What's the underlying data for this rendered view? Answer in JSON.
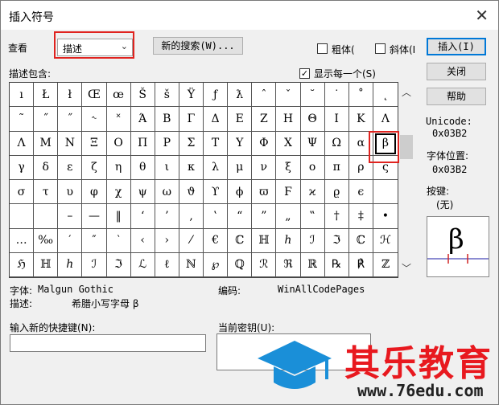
{
  "dialog": {
    "title": "插入符号",
    "close_glyph": "✕"
  },
  "search": {
    "view_label": "查看",
    "view_value": "描述",
    "new_search_label": "新的搜索(W)...",
    "bold_label": "粗体(",
    "italic_label": "斜体(I",
    "desc_contains_label": "描述包含:",
    "show_each_label": "显示每一个(S)",
    "show_each_checked": "✓"
  },
  "buttons": {
    "insert": "插入(I)",
    "close": "关闭",
    "help": "帮助"
  },
  "grid": {
    "rows": [
      [
        "ı",
        "Ł",
        "ł",
        "Œ",
        "œ",
        "Š",
        "š",
        "Ÿ",
        "ƒ",
        "ƛ",
        "ˆ",
        "ˇ",
        "˘",
        "˙",
        "˚",
        "˛"
      ],
      [
        "˜",
        "˝",
        "˝",
        "˞",
        "˟",
        "Ά",
        "Β",
        "Γ",
        "Δ",
        "Ε",
        "Ζ",
        "Η",
        "Θ",
        "Ι",
        "Κ",
        "Λ"
      ],
      [
        "Λ",
        "Μ",
        "Ν",
        "Ξ",
        "Ο",
        "Π",
        "Ρ",
        "Σ",
        "Τ",
        "Υ",
        "Φ",
        "Χ",
        "Ψ",
        "Ω",
        "α",
        "β"
      ],
      [
        "γ",
        "δ",
        "ε",
        "ζ",
        "η",
        "θ",
        "ι",
        "κ",
        "λ",
        "μ",
        "ν",
        "ξ",
        "ο",
        "π",
        "ρ",
        "ς"
      ],
      [
        "σ",
        "τ",
        "υ",
        "φ",
        "χ",
        "ψ",
        "ω",
        "ϑ",
        "ϒ",
        "ϕ",
        "ϖ",
        "Ϝ",
        "ϰ",
        "ϱ",
        "ϵ",
        ""
      ],
      [
        "",
        "",
        "–",
        "—",
        "‖",
        "‘",
        "’",
        "‚",
        "‛",
        "“",
        "”",
        "„",
        "‟",
        "†",
        "‡",
        "•"
      ],
      [
        "…",
        "‰",
        "′",
        "″",
        "‵",
        "‹",
        "›",
        "⁄",
        "€",
        "ℂ",
        "ℍ",
        "ℎ",
        "ℐ",
        "ℑ",
        "ℂ",
        "ℋ"
      ],
      [
        "ℌ",
        "ℍ",
        "ℎ",
        "ℐ",
        "ℑ",
        "ℒ",
        "ℓ",
        "ℕ",
        "℘",
        "ℚ",
        "ℛ",
        "ℜ",
        "ℝ",
        "℞",
        "℟",
        "ℤ"
      ]
    ]
  },
  "info": {
    "unicode_label": "Unicode:",
    "unicode_value": "0x03B2",
    "font_pos_label": "字体位置:",
    "font_pos_value": "0x03B2",
    "shortcut_label": "按键:",
    "shortcut_value": "(无)",
    "preview_char": "β"
  },
  "status": {
    "font_label": "字体:",
    "font_value": "Malgun Gothic",
    "encoding_label": "编码:",
    "encoding_value": "WinAllCodePages",
    "desc_label": "描述:",
    "desc_value": "希腊小写字母 β"
  },
  "shortcut": {
    "new_key_label": "输入新的快捷键(N):",
    "current_key_label": "当前密钥(U):"
  },
  "watermark": {
    "text": "其乐教育",
    "url": "www.76edu.com",
    "color": "#e8191f",
    "icon_color": "#1a8fd8"
  }
}
